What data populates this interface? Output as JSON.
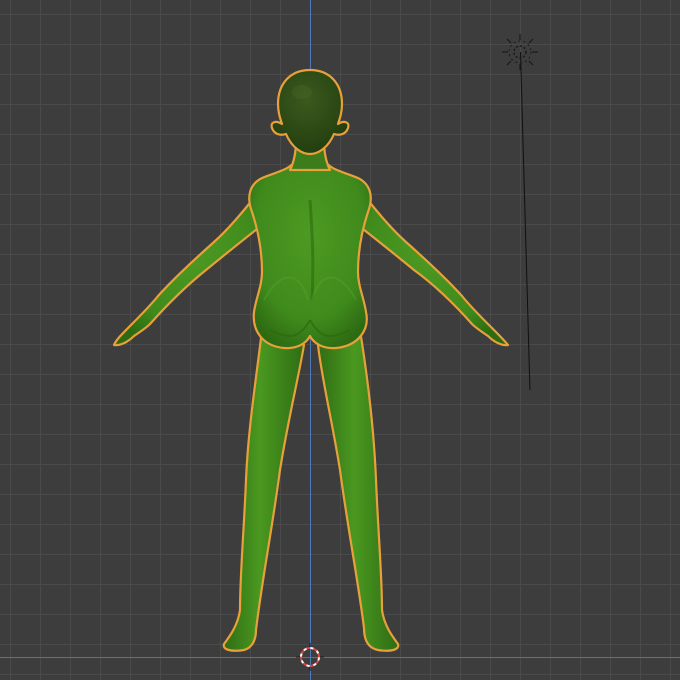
{
  "viewport": {
    "background": "#3d3d3d",
    "grid_color": "#4a4a4a",
    "axis_z_color": "#4f78b8",
    "axis_x_color": "#b0525a"
  },
  "object": {
    "type": "humanoid-mesh",
    "view": "back",
    "selected": true,
    "body_color": "#3f8a1c",
    "outline_color": "#e8a13a"
  },
  "light": {
    "icon": "sun-light-icon",
    "color": "#1a1a1a"
  },
  "cursor": {
    "icon": "3d-cursor-icon",
    "colors": [
      "#ffffff",
      "#d9473f"
    ]
  }
}
